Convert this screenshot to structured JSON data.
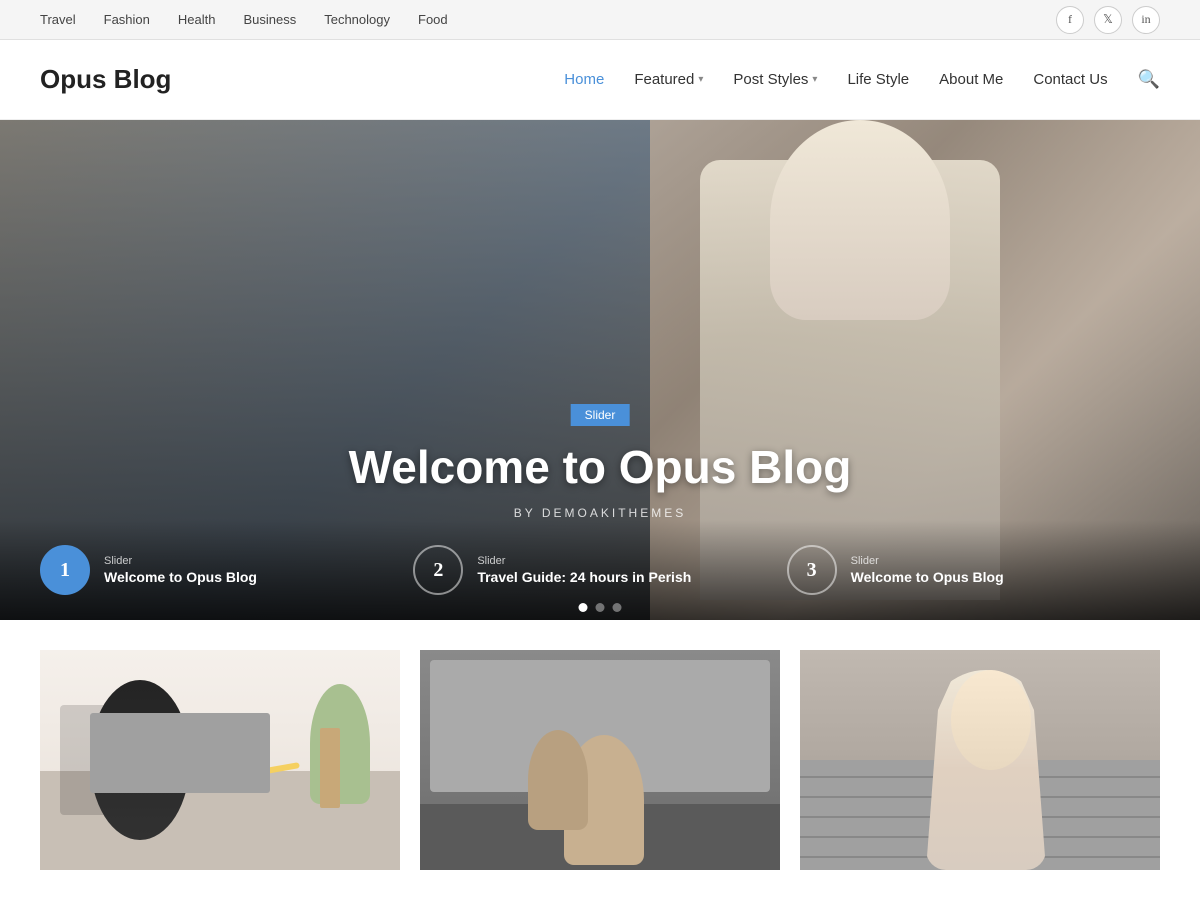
{
  "topbar": {
    "links": [
      {
        "label": "Travel",
        "href": "#"
      },
      {
        "label": "Fashion",
        "href": "#"
      },
      {
        "label": "Health",
        "href": "#"
      },
      {
        "label": "Business",
        "href": "#"
      },
      {
        "label": "Technology",
        "href": "#"
      },
      {
        "label": "Food",
        "href": "#"
      }
    ],
    "social": [
      {
        "name": "facebook",
        "icon": "f"
      },
      {
        "name": "twitter",
        "icon": "t"
      },
      {
        "name": "linkedin",
        "icon": "in"
      }
    ]
  },
  "header": {
    "logo": "Opus Blog",
    "nav": [
      {
        "label": "Home",
        "active": true
      },
      {
        "label": "Featured",
        "dropdown": true
      },
      {
        "label": "Post Styles",
        "dropdown": true
      },
      {
        "label": "Life Style",
        "dropdown": false
      },
      {
        "label": "About Me",
        "dropdown": false
      },
      {
        "label": "Contact Us",
        "dropdown": false
      }
    ]
  },
  "hero": {
    "badge": "Slider",
    "title": "Welcome to Opus Blog",
    "byline": "BY DEMOAKITHEMES",
    "slides": [
      {
        "number": "1",
        "cat": "Slider",
        "title": "Welcome to Opus Blog",
        "active": true
      },
      {
        "number": "2",
        "cat": "Slider",
        "title": "Travel Guide: 24 hours in Perish",
        "active": false
      },
      {
        "number": "3",
        "cat": "Slider",
        "title": "Welcome to Opus Blog",
        "active": false
      }
    ],
    "dots": [
      true,
      false,
      false
    ]
  },
  "cards": [
    {
      "id": 1,
      "alt": "Office desk with laptop"
    },
    {
      "id": 2,
      "alt": "Mother and child outdoors"
    },
    {
      "id": 3,
      "alt": "Young woman portrait"
    }
  ],
  "colors": {
    "accent": "#4a90d9",
    "dark": "#222",
    "text": "#444",
    "light_bg": "#f5f5f5"
  }
}
